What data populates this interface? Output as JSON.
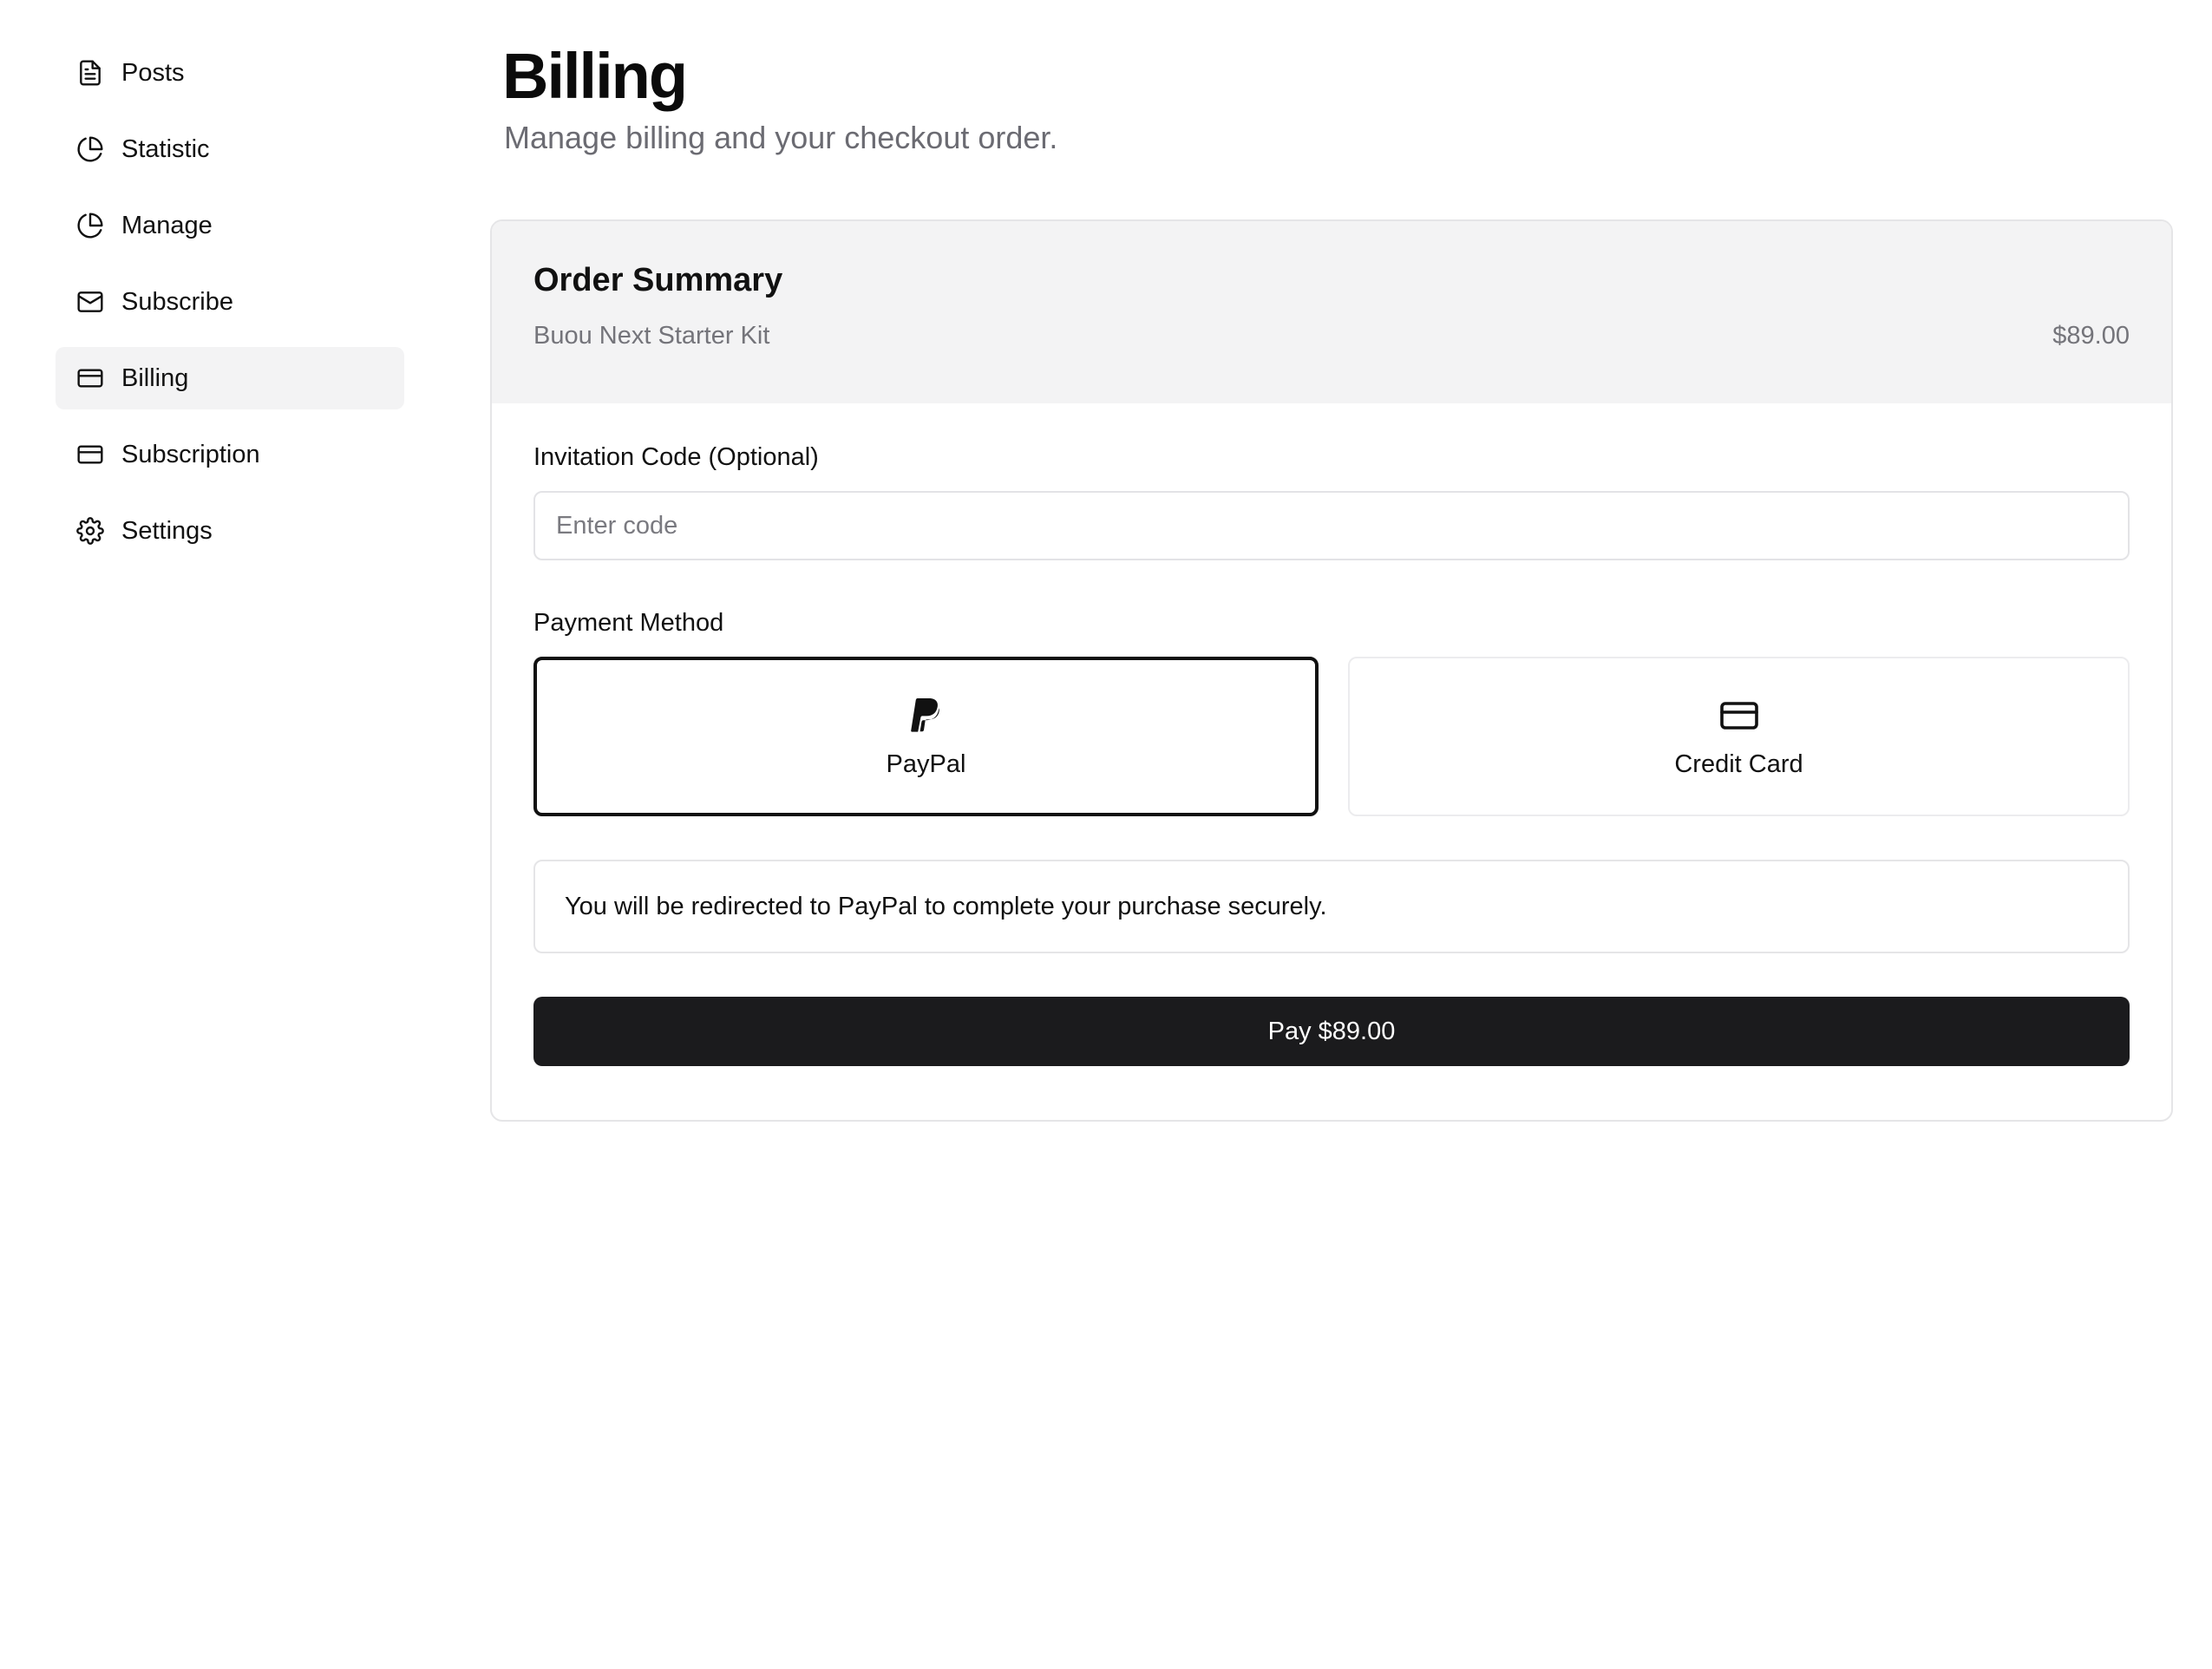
{
  "sidebar": {
    "items": [
      {
        "label": "Posts",
        "icon": "file-text-icon",
        "active": false
      },
      {
        "label": "Statistic",
        "icon": "pie-chart-icon",
        "active": false
      },
      {
        "label": "Manage",
        "icon": "pie-chart-icon",
        "active": false
      },
      {
        "label": "Subscribe",
        "icon": "mail-icon",
        "active": false
      },
      {
        "label": "Billing",
        "icon": "credit-card-icon",
        "active": true
      },
      {
        "label": "Subscription",
        "icon": "credit-card-icon",
        "active": false
      },
      {
        "label": "Settings",
        "icon": "gear-icon",
        "active": false
      }
    ]
  },
  "page": {
    "title": "Billing",
    "subtitle": "Manage billing and your checkout order."
  },
  "order_summary": {
    "title": "Order Summary",
    "item_name": "Buou Next Starter Kit",
    "item_price": "$89.00"
  },
  "invitation": {
    "label": "Invitation Code (Optional)",
    "placeholder": "Enter code",
    "value": ""
  },
  "payment": {
    "label": "Payment Method",
    "methods": [
      {
        "label": "PayPal",
        "icon": "paypal-icon",
        "selected": true
      },
      {
        "label": "Credit Card",
        "icon": "credit-card-icon",
        "selected": false
      }
    ],
    "notice": "You will be redirected to PayPal to complete your purchase securely.",
    "pay_button_label": "Pay $89.00"
  },
  "colors": {
    "accent": "#1b1b1d",
    "active_nav_bg": "#f3f3f4",
    "muted_text": "#6b6b72"
  }
}
